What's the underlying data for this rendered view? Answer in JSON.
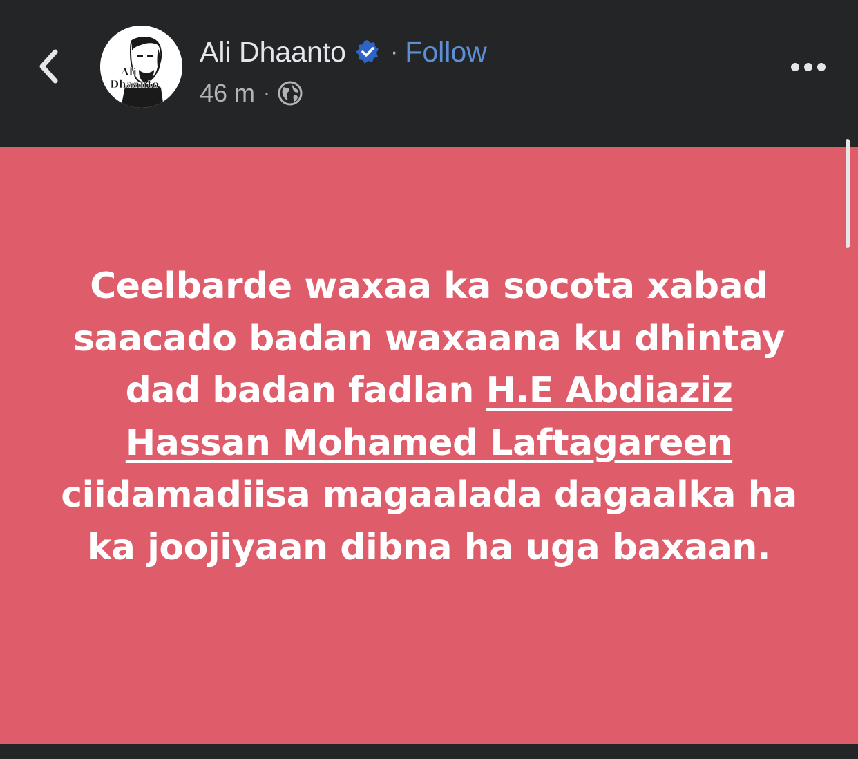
{
  "header": {
    "author_name": "Ali Dhaanto",
    "separator": "·",
    "follow_label": "Follow",
    "timestamp": "46 m",
    "meta_separator": "·",
    "privacy_icon": "globe-icon",
    "back_icon": "chevron-left-icon",
    "more_icon": "more-horizontal-icon",
    "verified_icon": "verified-badge-icon",
    "avatar_logo_line1": "Ali",
    "avatar_logo_line2": "Dhaanto"
  },
  "post": {
    "background_color": "#df5d6b",
    "text_before_mention": "Ceelbarde waxaa ka socota xabad saacado badan waxaana ku dhintay dad badan fadlan ",
    "mention": "H.E Abdiaziz Hassan Mohamed Laftagareen",
    "text_after_mention": " ciidamadiisa magaalada dagaalka ha ka joojiyaan dibna ha uga baxaan."
  },
  "colors": {
    "header_bg": "#242526",
    "name_text": "#e4e6eb",
    "secondary_text": "#b0b3b8",
    "follow_link": "#5c8fd6",
    "verified_badge": "#2d64c5"
  }
}
